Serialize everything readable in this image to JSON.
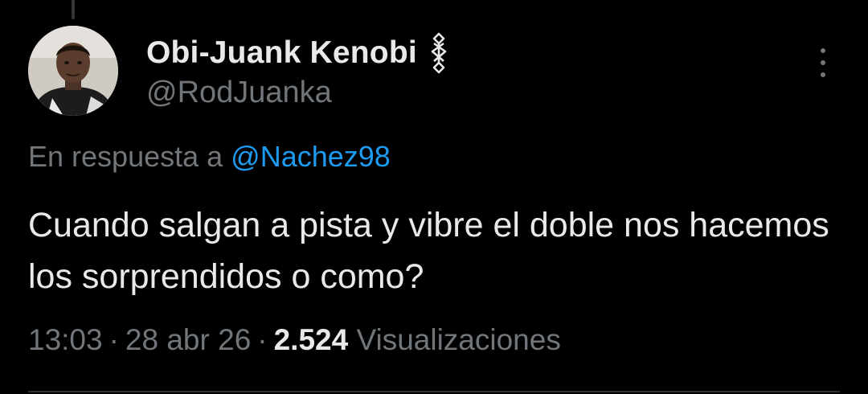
{
  "tweet": {
    "author": {
      "display_name": "Obi-Juank Kenobi",
      "handle": "@RodJuanka",
      "badge_icon": "sword-symbol-icon"
    },
    "reply_context": {
      "prefix": "En respuesta a",
      "mention": "@Nachez98"
    },
    "text": "Cuando salgan a pista y vibre el doble nos hacemos los sorprendidos o como?",
    "meta": {
      "time": "13:03",
      "separator": "·",
      "date": "28 abr 26",
      "views_count": "2.524",
      "views_label": "Visualizaciones"
    }
  },
  "colors": {
    "background": "#000000",
    "primary_text": "#e7e9ea",
    "secondary_text": "#71767b",
    "link": "#1d9bf0"
  },
  "icons": {
    "more": "more-vertical-icon"
  }
}
